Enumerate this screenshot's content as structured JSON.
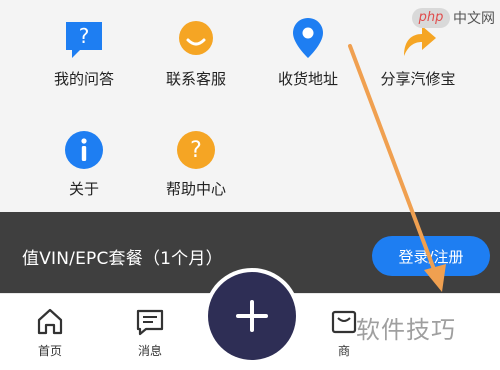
{
  "grid": {
    "items": [
      {
        "label": "我的问答",
        "icon": "question-bubble-icon"
      },
      {
        "label": "联系客服",
        "icon": "customer-service-icon"
      },
      {
        "label": "收货地址",
        "icon": "location-pin-icon"
      },
      {
        "label": "分享汽修宝",
        "icon": "share-arrow-icon"
      },
      {
        "label": "关于",
        "icon": "info-icon"
      },
      {
        "label": "帮助中心",
        "icon": "help-icon"
      }
    ]
  },
  "banner": {
    "promo_text": "值VIN/EPC套餐（1个月）",
    "login_label": "登录/注册"
  },
  "tabbar": {
    "tabs": [
      {
        "label": "首页",
        "icon": "home-icon"
      },
      {
        "label": "消息",
        "icon": "message-icon"
      },
      {
        "label": "商",
        "icon": "shop-icon"
      }
    ],
    "fab_icon": "plus-icon"
  },
  "watermarks": {
    "top_logo": "php",
    "top_text": "中文网",
    "bottom_text": "软件技巧"
  },
  "colors": {
    "primary_blue": "#1e7ef2",
    "accent_orange": "#f5a524",
    "banner_bg": "#3f3f3f",
    "fab_bg": "#2e2e55"
  }
}
